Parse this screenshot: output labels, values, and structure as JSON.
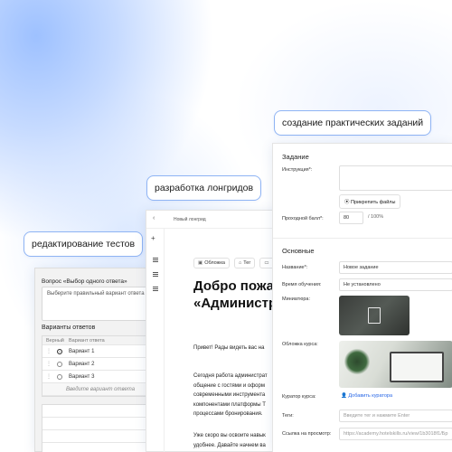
{
  "chips": {
    "tests": "редактирование тестов",
    "longreads": "разработка лонгридов",
    "tasks": "создание практических заданий"
  },
  "tests_panel": {
    "question_title": "Вопрос «Выбор одного ответа»",
    "question_placeholder": "Выберите правильный вариант ответа",
    "variants_title": "Варианты ответов",
    "col_correct": "Верный",
    "col_variant": "Вариант ответа",
    "variants": [
      "Вариант 1",
      "Вариант 2",
      "Вариант 3"
    ],
    "add_placeholder": "Введите вариант ответа"
  },
  "longread_panel": {
    "doc_name": "Новый лонгрид",
    "tag_cover": "Обложка",
    "tag_tag": "Тег",
    "heading_line1": "Добро пожа",
    "heading_line2": "«Администр",
    "para1": "Привет! Рады видеть вас на",
    "para2_l1": "Сегодня работа администрат",
    "para2_l2": "общение с гостями и оформ",
    "para2_l3": "современными инструмента",
    "para2_l4": "компонентами платформы Т",
    "para2_l5": "процессами бронирования.",
    "para3_l1": "Уже скоро вы освоите навык",
    "para3_l2": "удобнее. Давайте начнем ва"
  },
  "tasks_panel": {
    "section_task": "Задание",
    "label_instruction": "Инструкция*:",
    "attach_button": "Прикрепить файлы",
    "label_pass_score": "Проходной балл*:",
    "pass_score_value": "80",
    "pass_score_max": "/ 100%",
    "section_main": "Основные",
    "label_name": "Название*:",
    "name_value": "Новое задание",
    "label_time": "Время обучения:",
    "time_value": "Не установлено",
    "label_mini": "Миниатюра:",
    "label_cover": "Обложка курса:",
    "label_curator": "Куратор курса:",
    "add_curator": "Добавить куратора",
    "label_tags": "Теги:",
    "tags_placeholder": "Введите тег и нажмите Enter",
    "label_link": "Ссылка на просмотр:",
    "link_value": "https://academy.hotelskills.ru/view/1b3018f1/Бр"
  }
}
